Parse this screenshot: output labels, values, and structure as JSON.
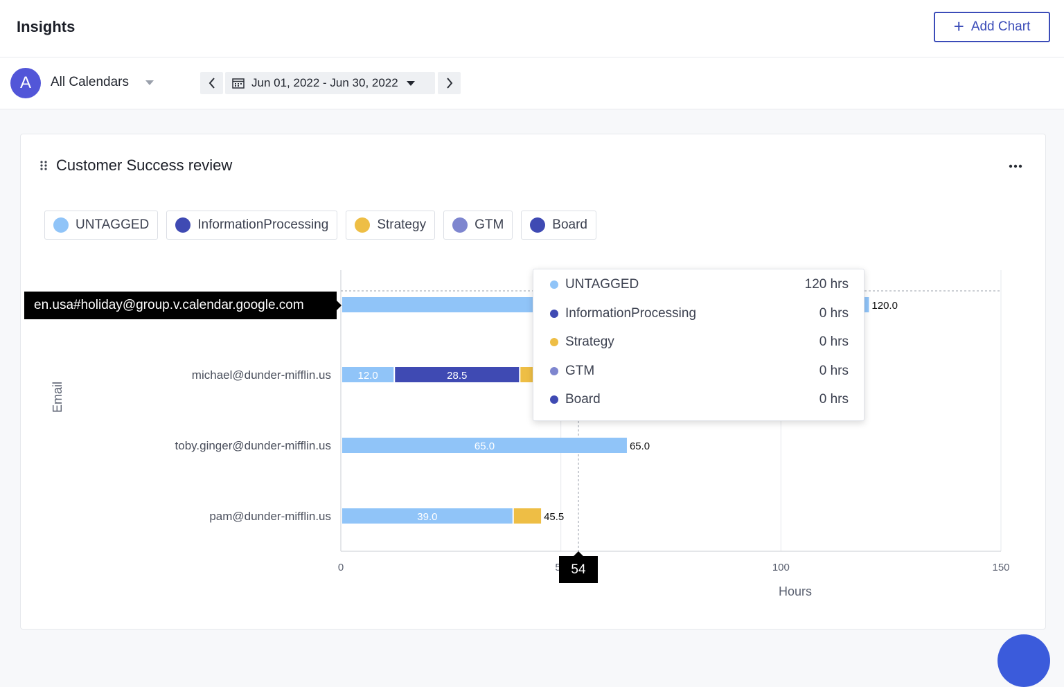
{
  "header": {
    "title": "Insights",
    "add_chart_label": "Add Chart"
  },
  "filters": {
    "avatar_letter": "A",
    "calendar_label": "All Calendars",
    "date_range": "Jun 01, 2022 - Jun 30, 2022"
  },
  "card": {
    "title": "Customer Success review",
    "legend": [
      {
        "label": "UNTAGGED",
        "color": "#90c4f8"
      },
      {
        "label": "InformationProcessing",
        "color": "#3f4ab3"
      },
      {
        "label": "Strategy",
        "color": "#eebe45"
      },
      {
        "label": "GTM",
        "color": "#7e86cf"
      },
      {
        "label": "Board",
        "color": "#3f4ab3"
      }
    ]
  },
  "chart_data": {
    "type": "bar",
    "orientation": "horizontal",
    "stacked": true,
    "xlabel": "Hours",
    "ylabel": "Email",
    "xlim": [
      0,
      150
    ],
    "x_ticks": [
      "0",
      "50",
      "100",
      "150"
    ],
    "categories": [
      "en.usa#holiday@group.v.calendar.google.com",
      "michael@dunder-mifflin.us",
      "toby.ginger@dunder-mifflin.us",
      "pam@dunder-mifflin.us"
    ],
    "category_labels_visible": [
      "",
      "michael@dunder-mifflin.us",
      "toby.ginger@dunder-mifflin.us",
      "pam@dunder-mifflin.us"
    ],
    "series": [
      {
        "name": "UNTAGGED",
        "color": "#90c4f8",
        "values": [
          120,
          12.0,
          65.0,
          39.0
        ],
        "labels": [
          "",
          "12.0",
          "65.0",
          "39.0"
        ]
      },
      {
        "name": "InformationProcessing",
        "color": "#3f4ab3",
        "values": [
          0,
          28.5,
          0,
          0
        ],
        "labels": [
          "",
          "28.5",
          "",
          ""
        ]
      },
      {
        "name": "Strategy",
        "color": "#eebe45",
        "values": [
          0,
          6.5,
          0,
          6.5
        ],
        "labels": [
          "",
          "",
          "",
          ""
        ]
      },
      {
        "name": "GTM",
        "color": "#7e86cf",
        "values": [
          0,
          0,
          0,
          0
        ],
        "labels": [
          "",
          "",
          "",
          ""
        ]
      },
      {
        "name": "Board",
        "color": "#3f4ab3",
        "values": [
          0,
          0,
          0,
          0
        ],
        "labels": [
          "",
          "",
          "",
          ""
        ]
      }
    ],
    "totals_labels": [
      "120.0",
      "",
      "65.0",
      "45.5"
    ]
  },
  "tooltip": {
    "rows": [
      {
        "label": "UNTAGGED",
        "value": "120 hrs",
        "color": "#90c4f8"
      },
      {
        "label": "InformationProcessing",
        "value": "0 hrs",
        "color": "#3f4ab3"
      },
      {
        "label": "Strategy",
        "value": "0 hrs",
        "color": "#eebe45"
      },
      {
        "label": "GTM",
        "value": "0 hrs",
        "color": "#7e86cf"
      },
      {
        "label": "Board",
        "value": "0 hrs",
        "color": "#3f4ab3"
      }
    ],
    "hover_category": "en.usa#holiday@group.v.calendar.google.com",
    "cursor_x_value": "54"
  }
}
